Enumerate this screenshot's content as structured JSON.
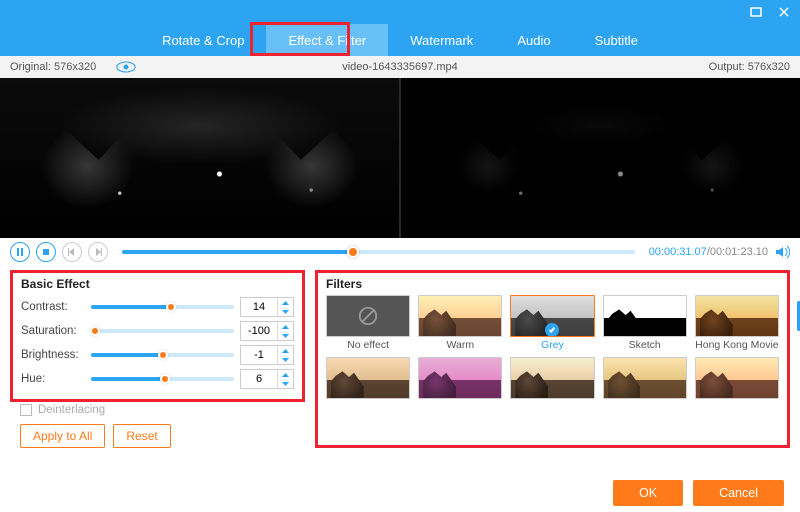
{
  "window": {
    "minimize": "—",
    "close": "×"
  },
  "tabs": [
    "Rotate & Crop",
    "Effect & Filter",
    "Watermark",
    "Audio",
    "Subtitle"
  ],
  "active_tab": 1,
  "info": {
    "original_label": "Original: 576x320",
    "filename": "video-1643335697.mp4",
    "output_label": "Output: 576x320"
  },
  "player": {
    "current": "00:00:31.07",
    "duration": "00:01:23.10",
    "progress_pct": 45
  },
  "basic": {
    "title": "Basic Effect",
    "rows": [
      {
        "label": "Contrast:",
        "value": 14,
        "pct": 56
      },
      {
        "label": "Saturation:",
        "value": -100,
        "pct": 3
      },
      {
        "label": "Brightness:",
        "value": -1,
        "pct": 50
      },
      {
        "label": "Hue:",
        "value": 6,
        "pct": 52
      }
    ],
    "deinterlacing": "Deinterlacing",
    "apply": "Apply to All",
    "reset": "Reset"
  },
  "filters": {
    "title": "Filters",
    "items": [
      {
        "name": "No effect",
        "cls": "noeffect",
        "selected": false,
        "none": true
      },
      {
        "name": "Warm",
        "cls": "f-warm",
        "selected": false
      },
      {
        "name": "Grey",
        "cls": "f-grey",
        "selected": true
      },
      {
        "name": "Sketch",
        "cls": "f-sketch",
        "selected": false
      },
      {
        "name": "Hong Kong Movie",
        "cls": "f-hk",
        "selected": false
      },
      {
        "name": "",
        "cls": "f-a",
        "selected": false
      },
      {
        "name": "",
        "cls": "f-b",
        "selected": false
      },
      {
        "name": "",
        "cls": "f-c",
        "selected": false
      },
      {
        "name": "",
        "cls": "f-d",
        "selected": false
      },
      {
        "name": "",
        "cls": "f-e",
        "selected": false
      }
    ]
  },
  "footer": {
    "ok": "OK",
    "cancel": "Cancel"
  }
}
